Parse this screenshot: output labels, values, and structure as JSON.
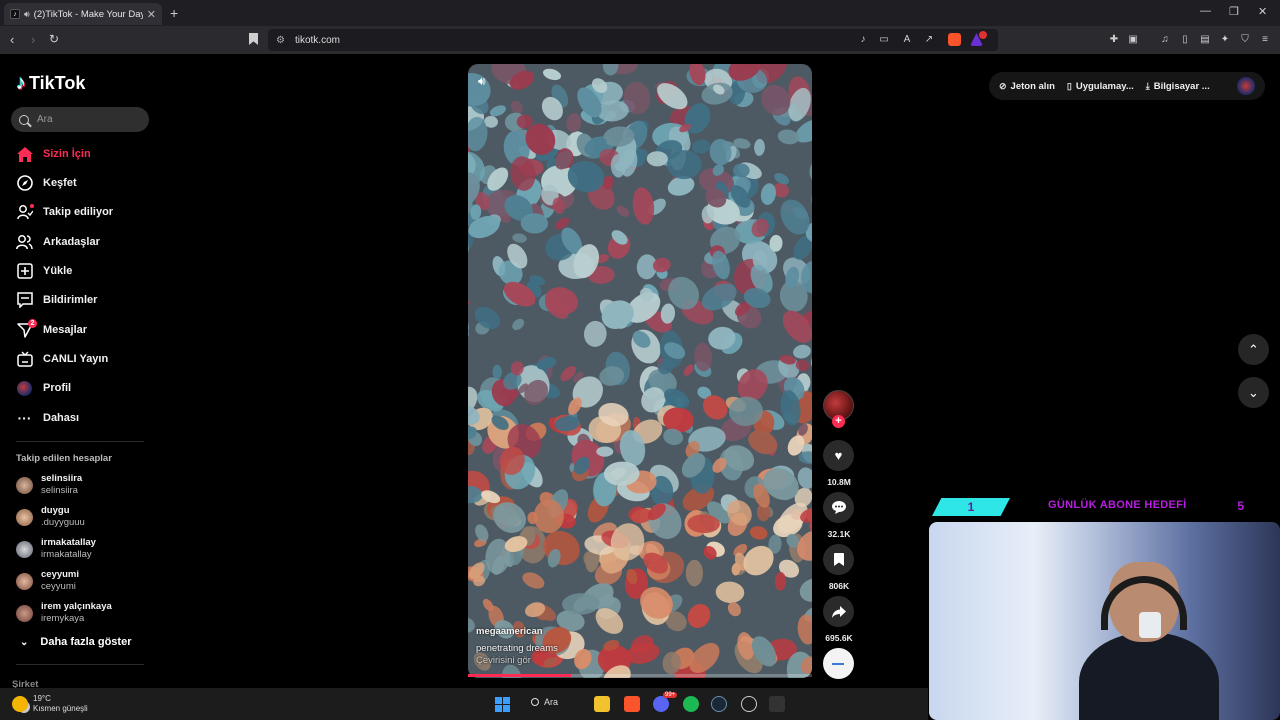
{
  "browser": {
    "tab_title": "(2)TikTok - Make Your Day",
    "url": "tikotk.com"
  },
  "sidebar": {
    "logo": "TikTok",
    "search_placeholder": "Ara",
    "nav": [
      {
        "label": "Sizin İçin",
        "icon": "home-icon",
        "active": true
      },
      {
        "label": "Keşfet",
        "icon": "compass-icon"
      },
      {
        "label": "Takip ediliyor",
        "icon": "following-icon"
      },
      {
        "label": "Arkadaşlar",
        "icon": "friends-icon"
      },
      {
        "label": "Yükle",
        "icon": "upload-icon"
      },
      {
        "label": "Bildirimler",
        "icon": "inbox-icon"
      },
      {
        "label": "Mesajlar",
        "icon": "messages-icon",
        "badge": "2"
      },
      {
        "label": "CANLI Yayın",
        "icon": "live-icon"
      },
      {
        "label": "Profil",
        "icon": "avatar"
      },
      {
        "label": "Dahası",
        "icon": "more-icon"
      }
    ],
    "following_title": "Takip edilen hesaplar",
    "following": [
      {
        "name": "selinsiira",
        "handle": "selinsiira"
      },
      {
        "name": "duygu",
        "handle": ".duyyguuu"
      },
      {
        "name": "irmakatallay",
        "handle": "irmakatallay"
      },
      {
        "name": "ceyyumi",
        "handle": "ceyyumi"
      },
      {
        "name": "irem yalçınkaya",
        "handle": "iremykaya"
      }
    ],
    "show_more": "Daha fazla göster",
    "company": "Şirket"
  },
  "video": {
    "author": "megaamerican",
    "caption": "penetrating dreams",
    "translate": "Çevirisini gör",
    "progress": 0.3
  },
  "actions": {
    "likes": "10.8M",
    "comments": "32.1K",
    "saves": "806K",
    "shares": "695.6K"
  },
  "topbar": {
    "coins": "Jeton alın",
    "app": "Uygulamay...",
    "desktop": "Bilgisayar ..."
  },
  "overlay": {
    "current": "1",
    "title": "GÜNLÜK ABONE HEDEFİ",
    "target": "5"
  },
  "taskbar": {
    "temp": "19°C",
    "weather": "Kısmen güneşli",
    "search": "Ara",
    "discord_badge": "99+"
  },
  "colors": {
    "accent": "#fe2c55",
    "overlay_cyan": "#2ee6e6",
    "overlay_purple": "#b71de0"
  }
}
